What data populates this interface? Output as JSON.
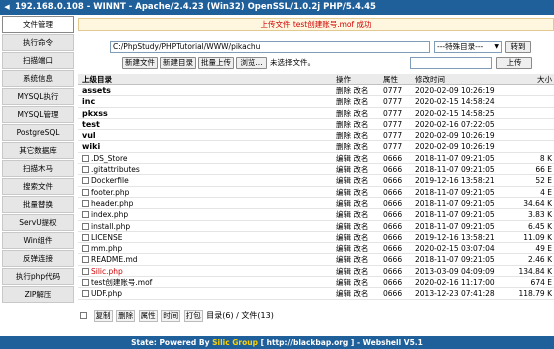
{
  "title": {
    "arrow": "◀",
    "text": "192.168.0.108 - WINNT - Apache/2.4.23 (Win32) OpenSSL/1.0.2j PHP/5.4.45"
  },
  "sidebar": {
    "items": [
      "文件管理",
      "执行命令",
      "扫描端口",
      "系统信息",
      "MYSQL执行",
      "MYSQL管理",
      "PostgreSQL",
      "其它数据库",
      "扫描木马",
      "搜索文件",
      "批量替换",
      "ServU提权",
      "Win组件",
      "反弹连接",
      "执行php代码",
      "ZIP解压"
    ]
  },
  "message": "上传文件 test创建账号.mof 成功",
  "path": {
    "value": "C:/PhpStudy/PHPTutorial/WWW/pikachu",
    "select_value": "---特殊目录---",
    "goto_label": "转到"
  },
  "toolbar": {
    "new_file": "新建文件",
    "new_dir": "新建目录",
    "batch_upload": "批量上传",
    "browse": "浏览...",
    "no_file": "未选择文件。",
    "upload": "上传"
  },
  "table": {
    "headers": {
      "name": "上级目录",
      "ops": "操作",
      "perm": "属性",
      "mtime": "修改时间",
      "size": "大小"
    },
    "dirs": [
      {
        "name": "assets",
        "ops": "删除 改名",
        "perm": "0777",
        "mtime": "2020-02-09 10:26:19"
      },
      {
        "name": "inc",
        "ops": "删除 改名",
        "perm": "0777",
        "mtime": "2020-02-15 14:58:24"
      },
      {
        "name": "pkxss",
        "ops": "删除 改名",
        "perm": "0777",
        "mtime": "2020-02-15 14:58:25"
      },
      {
        "name": "test",
        "ops": "删除 改名",
        "perm": "0777",
        "mtime": "2020-02-16 07:22:05"
      },
      {
        "name": "vul",
        "ops": "删除 改名",
        "perm": "0777",
        "mtime": "2020-02-09 10:26:19"
      },
      {
        "name": "wiki",
        "ops": "删除 改名",
        "perm": "0777",
        "mtime": "2020-02-09 10:26:19"
      }
    ],
    "files": [
      {
        "name": ".DS_Store",
        "ops": "编辑 改名",
        "perm": "0666",
        "mtime": "2018-11-07 09:21:05",
        "size": "8 K",
        "red": false
      },
      {
        "name": ".gitattributes",
        "ops": "编辑 改名",
        "perm": "0666",
        "mtime": "2018-11-07 09:21:05",
        "size": "66 E",
        "red": false
      },
      {
        "name": "Dockerfile",
        "ops": "编辑 改名",
        "perm": "0666",
        "mtime": "2019-12-16 13:58:21",
        "size": "52 E",
        "red": false
      },
      {
        "name": "footer.php",
        "ops": "编辑 改名",
        "perm": "0666",
        "mtime": "2018-11-07 09:21:05",
        "size": "4 E",
        "red": false
      },
      {
        "name": "header.php",
        "ops": "编辑 改名",
        "perm": "0666",
        "mtime": "2018-11-07 09:21:05",
        "size": "34.64 K",
        "red": false
      },
      {
        "name": "index.php",
        "ops": "编辑 改名",
        "perm": "0666",
        "mtime": "2018-11-07 09:21:05",
        "size": "3.83 K",
        "red": false
      },
      {
        "name": "install.php",
        "ops": "编辑 改名",
        "perm": "0666",
        "mtime": "2018-11-07 09:21:05",
        "size": "6.45 K",
        "red": false
      },
      {
        "name": "LICENSE",
        "ops": "编辑 改名",
        "perm": "0666",
        "mtime": "2019-12-16 13:58:21",
        "size": "11.09 K",
        "red": false
      },
      {
        "name": "mm.php",
        "ops": "编辑 改名",
        "perm": "0666",
        "mtime": "2020-02-15 03:07:04",
        "size": "49 E",
        "red": false
      },
      {
        "name": "README.md",
        "ops": "编辑 改名",
        "perm": "0666",
        "mtime": "2018-11-07 09:21:05",
        "size": "2.46 K",
        "red": false
      },
      {
        "name": "Silic.php",
        "ops": "编辑 改名",
        "perm": "0666",
        "mtime": "2013-03-09 04:09:09",
        "size": "134.84 K",
        "red": true
      },
      {
        "name": "test创建账号.mof",
        "ops": "编辑 改名",
        "perm": "0666",
        "mtime": "2020-02-16 11:17:00",
        "size": "674 E",
        "red": false
      },
      {
        "name": "UDF.php",
        "ops": "编辑 改名",
        "perm": "0666",
        "mtime": "2013-12-23 07:41:28",
        "size": "118.79 K",
        "red": false
      }
    ]
  },
  "footer": {
    "copy": "复制",
    "delete": "删除",
    "attr": "属性",
    "time": "时间",
    "pack": "打包",
    "summary": "目录(6) / 文件(13)"
  },
  "status": {
    "prefix": "State: Powered By ",
    "brand": "Silic Group",
    "suffix": " [ http://blackbap.org ] - Webshell V5.1"
  }
}
